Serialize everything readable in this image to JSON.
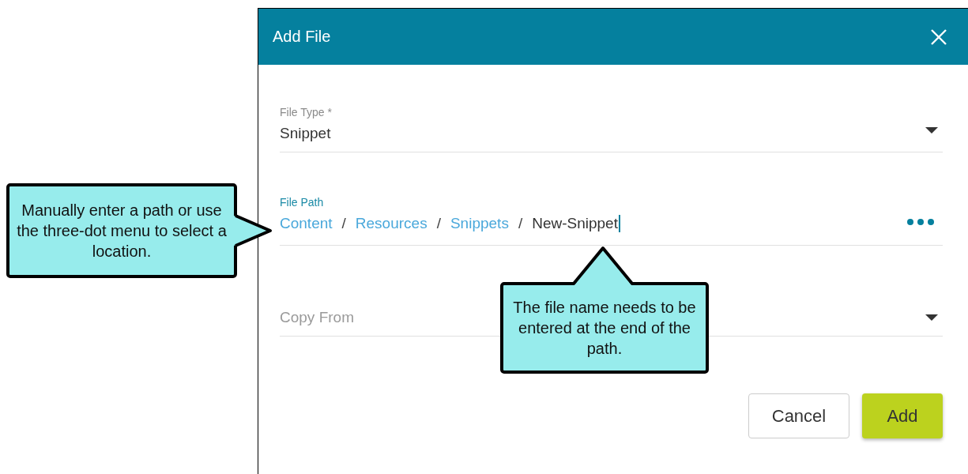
{
  "dialog": {
    "title": "Add File",
    "file_type": {
      "label": "File Type *",
      "value": "Snippet"
    },
    "file_path": {
      "label": "File Path",
      "segments": [
        {
          "kind": "link",
          "text": "Content"
        },
        {
          "kind": "separator",
          "text": "/"
        },
        {
          "kind": "link",
          "text": "Resources"
        },
        {
          "kind": "separator",
          "text": "/"
        },
        {
          "kind": "link",
          "text": "Snippets"
        },
        {
          "kind": "separator",
          "text": "/"
        },
        {
          "kind": "name",
          "text": "New-Snippet"
        }
      ]
    },
    "copy_from": {
      "placeholder": "Copy From"
    },
    "buttons": [
      {
        "kind": "secondary",
        "label": "Cancel"
      },
      {
        "kind": "primary",
        "label": "Add"
      }
    ]
  },
  "callouts": [
    {
      "text": "Manually enter a path or use the three-dot menu to select a location."
    },
    {
      "text": "The file name needs to be entered at the end of the path."
    }
  ]
}
